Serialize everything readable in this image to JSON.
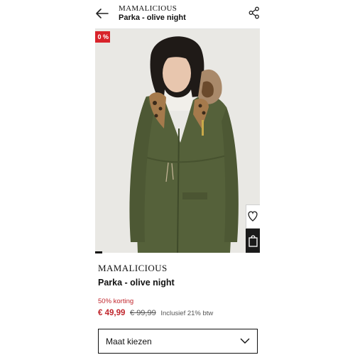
{
  "header": {
    "brand": "MAMALICIOUS",
    "title": "Parka - olive night"
  },
  "gallery": {
    "badge_text": "0 %",
    "badge_color": "#d8232a"
  },
  "product": {
    "brand": "MAMALICIOUS",
    "name": "Parka - olive night",
    "discount_text": "50% korting",
    "price_now": "€ 49,99",
    "price_old": "€ 99,99",
    "vat_note": "Inclusief 21% btw"
  },
  "size_selector": {
    "label": "Maat kiezen"
  },
  "colors": {
    "sale_red": "#c0262d",
    "jacket_olive": "#55613a"
  },
  "icons": [
    "back-arrow-icon",
    "share-icon",
    "heart-icon",
    "shopping-bag-icon",
    "chevron-down-icon"
  ]
}
